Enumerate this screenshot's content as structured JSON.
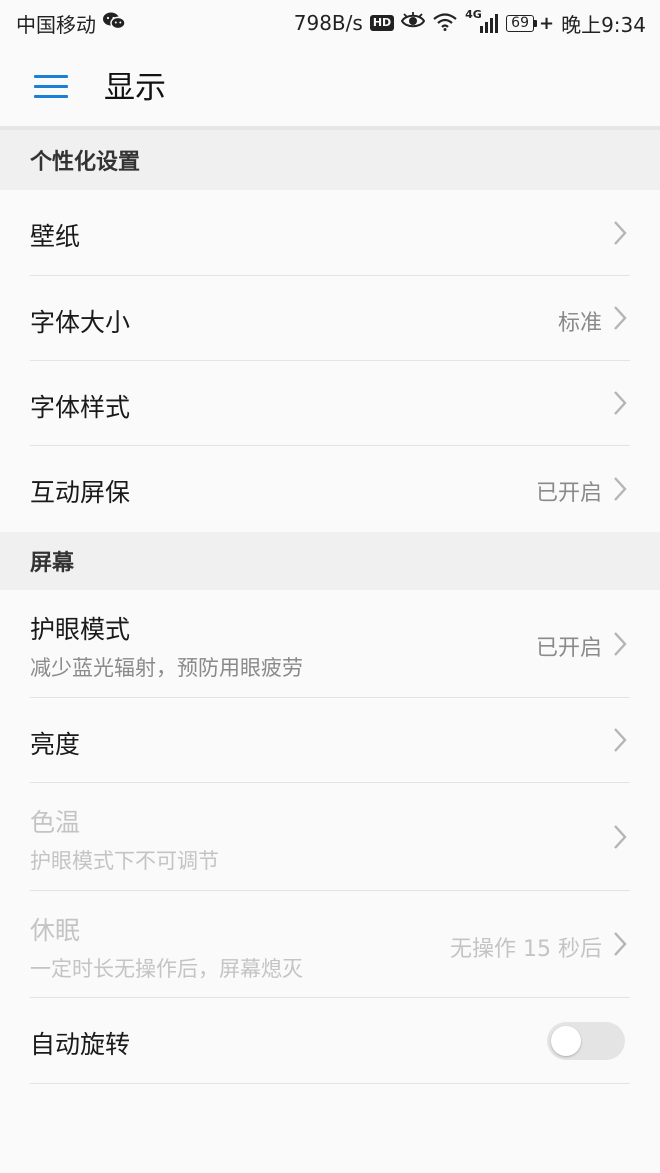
{
  "status_bar": {
    "carrier": "中国移动",
    "network_speed": "798B/s",
    "hd_badge": "HD",
    "network_type": "4G",
    "battery_level": "69",
    "time": "晚上9:34"
  },
  "app_bar": {
    "title": "显示",
    "accent_color": "#1a7fd6"
  },
  "sections": {
    "personalization": {
      "header": "个性化设置",
      "wallpaper": {
        "title": "壁纸"
      },
      "font_size": {
        "title": "字体大小",
        "value": "标准"
      },
      "font_style": {
        "title": "字体样式"
      },
      "screensaver": {
        "title": "互动屏保",
        "value": "已开启"
      }
    },
    "screen": {
      "header": "屏幕",
      "eye_comfort": {
        "title": "护眼模式",
        "subtitle": "减少蓝光辐射，预防用眼疲劳",
        "value": "已开启"
      },
      "brightness": {
        "title": "亮度"
      },
      "color_temp": {
        "title": "色温",
        "subtitle": "护眼模式下不可调节",
        "disabled": true
      },
      "sleep": {
        "title": "休眠",
        "subtitle": "一定时长无操作后，屏幕熄灭",
        "value": "无操作 15 秒后",
        "disabled": true
      },
      "auto_rotate": {
        "title": "自动旋转",
        "enabled": false
      }
    }
  }
}
